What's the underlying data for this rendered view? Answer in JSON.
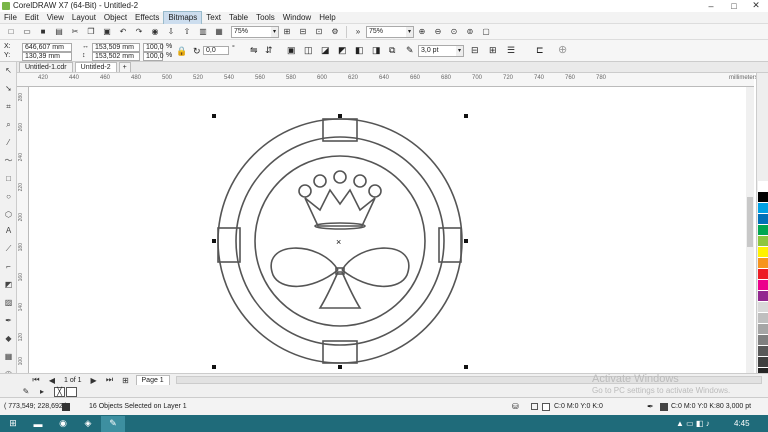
{
  "window": {
    "title": "CorelDRAW X7 (64-Bit) - Untitled-2",
    "min": "–",
    "max": "□",
    "close": "✕"
  },
  "menus": [
    "File",
    "Edit",
    "View",
    "Layout",
    "Object",
    "Effects",
    "Bitmaps",
    "Text",
    "Table",
    "Tools",
    "Window",
    "Help"
  ],
  "toolbar1": {
    "zoom1": "75%",
    "zoom2": "75%"
  },
  "props": {
    "x": "646,607 mm",
    "y": "130,39 mm",
    "w": "153,509 mm",
    "h": "153,502 mm",
    "sx": "100,0",
    "sy": "100,0",
    "pct1": "%",
    "pct2": "%",
    "angle": "0,0",
    "deg": "°",
    "outline": "3,0 pt"
  },
  "tabs": [
    "Untitled-1.cdr",
    "Untitled-2"
  ],
  "ruler": {
    "ticks": [
      "420",
      "440",
      "460",
      "480",
      "500",
      "520",
      "540",
      "560",
      "580",
      "600",
      "620",
      "640",
      "660",
      "680",
      "700",
      "720",
      "740",
      "760",
      "780"
    ],
    "unit": "millimeters",
    "vticks": [
      "280",
      "260",
      "240",
      "220",
      "200",
      "180",
      "160",
      "140",
      "120",
      "100",
      "80"
    ]
  },
  "pagenav": {
    "count": "1 of 1",
    "page": "Page 1"
  },
  "status": {
    "coords": "( 773,549; 228,692 )",
    "selection": "16 Objects Selected on Layer 1",
    "fill": "C:0 M:0 Y:0 K:0",
    "outline": "C:0 M:0 Y:0 K:80  3,000 pt"
  },
  "watermark": {
    "title": "Activate Windows",
    "sub": "Go to PC settings to activate Windows."
  },
  "taskbar": {
    "time": "4:45"
  },
  "palette": [
    "#ffffff",
    "#000000",
    "#00a0e3",
    "#0070b8",
    "#00a651",
    "#8dc63f",
    "#fff200",
    "#f7941d",
    "#ed1c24",
    "#ec008c",
    "#92278f",
    "#d9d9d9",
    "#bfbfbf",
    "#a6a6a6",
    "#808080",
    "#595959",
    "#404040",
    "#262626"
  ]
}
